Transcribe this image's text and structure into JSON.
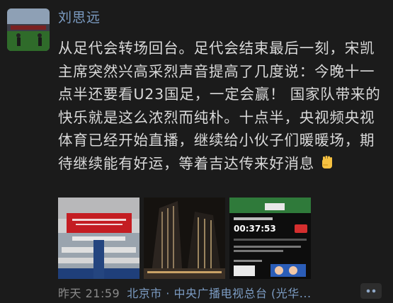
{
  "post": {
    "author": "刘思远",
    "text": "从足代会转场回台。足代会结束最后一刻，宋凯主席突然兴高采烈声音提高了几度说：今晚十一点半还要看U23国足，一定会赢！ 国家队带来的快乐就是这么浓烈而纯朴。十点半，央视频央视体育已经开始直播，继续给小伙子们暖暖场，期待继续能有好运，等着吉达传来好消息",
    "emoji": "raised-fist-emoji",
    "time": "昨天 21:59",
    "location": "北京市 · 中央广播电视总台 (光华..."
  },
  "photo3": {
    "score": "00:37:53"
  },
  "colors": {
    "background": "#1b1b1b",
    "author": "#7c9cc3",
    "text": "#d9d9d9",
    "meta": "#8a8a8a"
  }
}
